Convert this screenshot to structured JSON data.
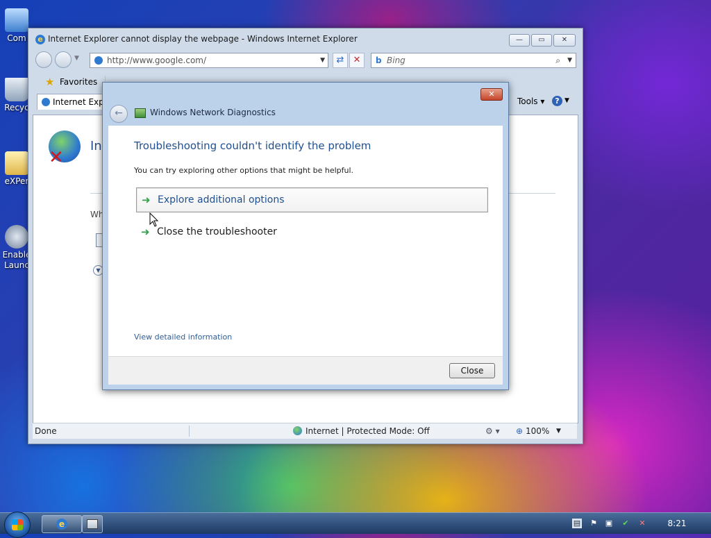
{
  "desktop": {
    "icons": [
      {
        "label": "Com"
      },
      {
        "label": "Recyc"
      },
      {
        "label": "eXPer"
      },
      {
        "label": "Enable\nLaunc"
      }
    ]
  },
  "ie": {
    "title": "Internet Explorer cannot display the webpage - Windows Internet Explorer",
    "address": "http://www.google.com/",
    "search_placeholder": "Bing",
    "favorites_label": "Favorites",
    "tab_label": "Internet Explo",
    "tools_label": "Tools",
    "content_heading_fragment": "Int",
    "content_line_fragment": "Wh",
    "status_left": "Done",
    "status_zone": "Internet | Protected Mode: Off",
    "zoom": "100%"
  },
  "dialog": {
    "window_title": "Windows Network Diagnostics",
    "heading": "Troubleshooting couldn't identify the problem",
    "subtext": "You can try exploring other options that might be helpful.",
    "options": [
      {
        "label": "Explore additional options"
      },
      {
        "label": "Close the troubleshooter"
      }
    ],
    "detail_link": "View detailed information",
    "close_button": "Close",
    "close_x": "✕"
  },
  "taskbar": {
    "clock": "8:21"
  },
  "colors": {
    "heading_blue": "#1f4f8f",
    "link_blue": "#2d5e9a",
    "arrow_green": "#2ea14a"
  }
}
